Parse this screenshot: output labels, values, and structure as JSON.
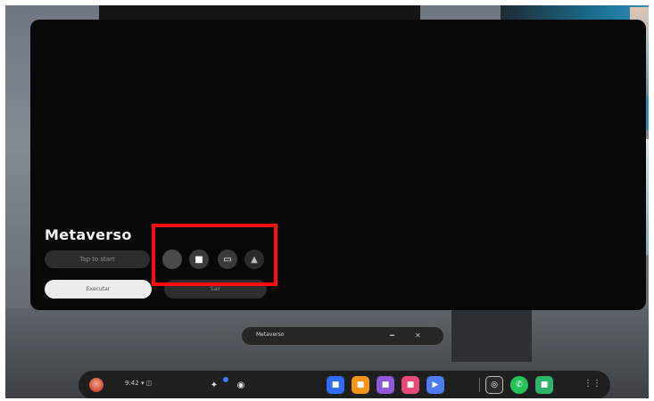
{
  "window": {
    "title": "Metaverso",
    "status_text": "Tap to start",
    "controls": [
      {
        "name": "mic-icon",
        "glyph": ""
      },
      {
        "name": "video-icon",
        "glyph": "■"
      },
      {
        "name": "screen-share-icon",
        "glyph": "▭"
      },
      {
        "name": "alert-icon",
        "glyph": "▲"
      }
    ],
    "buttons": {
      "primary_label": "Executar",
      "secondary_label": "Sair"
    }
  },
  "mini_window": {
    "title": "Metaverso"
  },
  "taskbar": {
    "time": "9:42  ▾  ◫",
    "quick_icons": [
      "notifications-icon",
      "visibility-icon"
    ],
    "apps": [
      {
        "name": "app-1",
        "color": "#2f6df6",
        "glyph": "■"
      },
      {
        "name": "app-2",
        "color": "#f7931a",
        "glyph": "■"
      },
      {
        "name": "app-3",
        "color": "#8e59d9",
        "glyph": "■"
      },
      {
        "name": "app-4",
        "color": "#e84a78",
        "glyph": "■"
      },
      {
        "name": "app-5",
        "color": "#4d7bf0",
        "glyph": "▶"
      },
      {
        "name": "app-6",
        "color": "#2a2a2a",
        "glyph": "◎"
      },
      {
        "name": "whatsapp",
        "color": "#27c25a",
        "glyph": "✆"
      },
      {
        "name": "app-8",
        "color": "#2fb36a",
        "glyph": "■"
      }
    ]
  },
  "highlight_color": "#ff0d0d"
}
